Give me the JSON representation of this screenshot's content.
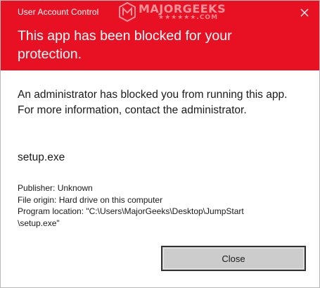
{
  "window": {
    "title": "User Account Control",
    "close_icon": "close-icon"
  },
  "header": {
    "headline": "This app has been blocked for your protection.",
    "background_color": "#e81123"
  },
  "watermark": {
    "text": "MAJORGEEKS",
    "sub": "★★★★★★.COM"
  },
  "body": {
    "message": "An administrator has blocked you from running this app. For more information, contact the administrator.",
    "app_name": "setup.exe",
    "publisher": "Publisher: Unknown",
    "file_origin": "File origin: Hard drive on this computer",
    "program_location_line1": "Program location: \"C:\\Users\\MajorGeeks\\Desktop\\JumpStart",
    "program_location_line2": "\\setup.exe\""
  },
  "buttons": {
    "close_label": "Close"
  }
}
